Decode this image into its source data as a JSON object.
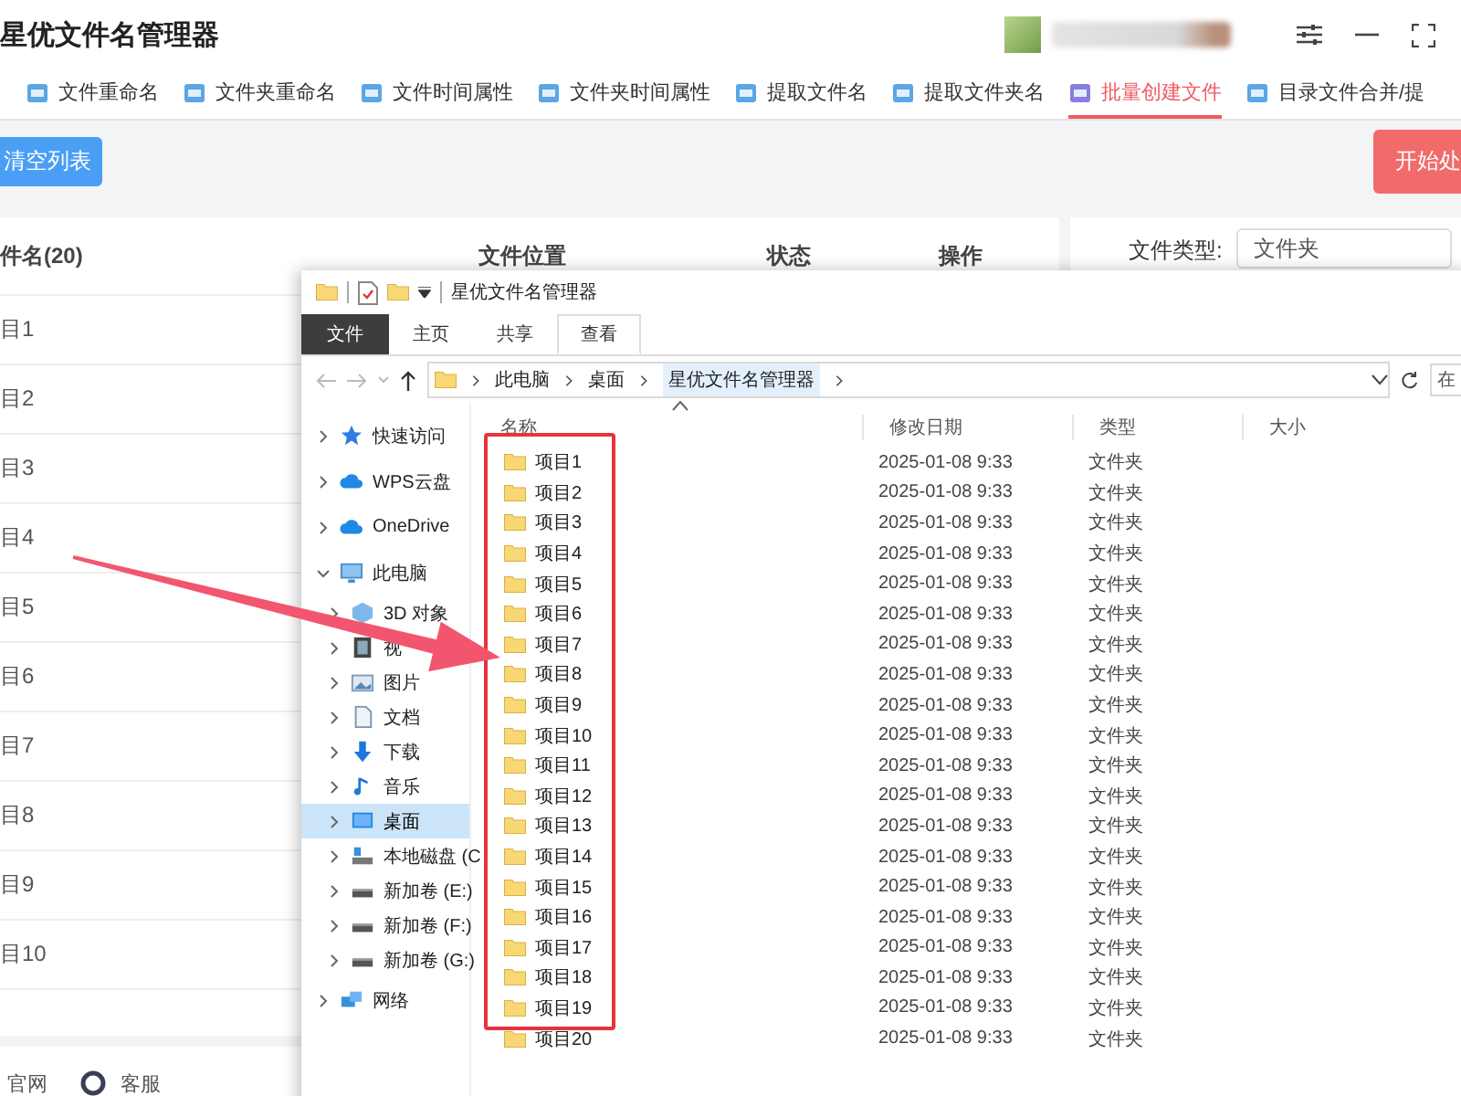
{
  "app": {
    "title": "星优文件名管理器",
    "tabs": [
      {
        "label": "文件重命名",
        "selected": false
      },
      {
        "label": "文件夹重命名",
        "selected": false
      },
      {
        "label": "文件时间属性",
        "selected": false
      },
      {
        "label": "文件夹时间属性",
        "selected": false
      },
      {
        "label": "提取文件名",
        "selected": false
      },
      {
        "label": "提取文件夹名",
        "selected": false
      },
      {
        "label": "批量创建文件",
        "selected": true
      },
      {
        "label": "目录文件合并/提",
        "selected": false
      }
    ],
    "clear_button": "清空列表",
    "start_button": "开始处",
    "table": {
      "columns": [
        "件名(20)",
        "文件位置",
        "状态",
        "操作"
      ],
      "rows": [
        "目1",
        "目2",
        "目3",
        "目4",
        "目5",
        "目6",
        "目7",
        "目8",
        "目9",
        "目10"
      ]
    },
    "file_type": {
      "label": "文件类型:",
      "value": "文件夹"
    },
    "footer": [
      "官网",
      "客服"
    ]
  },
  "explorer": {
    "title": "星优文件名管理器",
    "ribbon_tabs": [
      {
        "label": "文件",
        "kind": "menu",
        "selected": false
      },
      {
        "label": "主页",
        "kind": "tab",
        "selected": false
      },
      {
        "label": "共享",
        "kind": "tab",
        "selected": false
      },
      {
        "label": "查看",
        "kind": "tab",
        "selected": true
      }
    ],
    "breadcrumb": [
      "此电脑",
      "桌面",
      "星优文件名管理器"
    ],
    "search": {
      "placeholder": "在"
    },
    "columns": [
      "名称",
      "修改日期",
      "类型",
      "大小"
    ],
    "nav": [
      {
        "label": "快速访问",
        "kind": "star",
        "selected": false,
        "expanded": false
      },
      {
        "label": "WPS云盘",
        "kind": "cloud",
        "selected": false,
        "expanded": false
      },
      {
        "label": "OneDrive",
        "kind": "cloud",
        "selected": false,
        "expanded": false
      },
      {
        "label": "此电脑",
        "kind": "pc",
        "selected": false,
        "expanded": true,
        "children": [
          {
            "label": "3D 对象",
            "kind": "cube",
            "selected": false,
            "expanded": false
          },
          {
            "label": "视",
            "kind": "film",
            "selected": false,
            "expanded": false
          },
          {
            "label": "图片",
            "kind": "image",
            "selected": false,
            "expanded": false
          },
          {
            "label": "文档",
            "kind": "doc",
            "selected": false,
            "expanded": false
          },
          {
            "label": "下载",
            "kind": "download",
            "selected": false,
            "expanded": false
          },
          {
            "label": "音乐",
            "kind": "music",
            "selected": false,
            "expanded": false
          },
          {
            "label": "桌面",
            "kind": "desktop",
            "selected": true,
            "expanded": false
          },
          {
            "label": "本地磁盘 (C",
            "kind": "disk",
            "selected": false,
            "expanded": false
          },
          {
            "label": "新加卷 (E:)",
            "kind": "drive",
            "selected": false,
            "expanded": false
          },
          {
            "label": "新加卷 (F:)",
            "kind": "drive",
            "selected": false,
            "expanded": false
          },
          {
            "label": "新加卷 (G:)",
            "kind": "drive",
            "selected": false,
            "expanded": false
          }
        ]
      },
      {
        "label": "网络",
        "kind": "network",
        "selected": false,
        "expanded": false
      }
    ],
    "files": [
      {
        "name": "项目1",
        "date": "2025-01-08 9:33",
        "type": "文件夹"
      },
      {
        "name": "项目2",
        "date": "2025-01-08 9:33",
        "type": "文件夹"
      },
      {
        "name": "项目3",
        "date": "2025-01-08 9:33",
        "type": "文件夹"
      },
      {
        "name": "项目4",
        "date": "2025-01-08 9:33",
        "type": "文件夹"
      },
      {
        "name": "项目5",
        "date": "2025-01-08 9:33",
        "type": "文件夹"
      },
      {
        "name": "项目6",
        "date": "2025-01-08 9:33",
        "type": "文件夹"
      },
      {
        "name": "项目7",
        "date": "2025-01-08 9:33",
        "type": "文件夹"
      },
      {
        "name": "项目8",
        "date": "2025-01-08 9:33",
        "type": "文件夹"
      },
      {
        "name": "项目9",
        "date": "2025-01-08 9:33",
        "type": "文件夹"
      },
      {
        "name": "项目10",
        "date": "2025-01-08 9:33",
        "type": "文件夹"
      },
      {
        "name": "项目11",
        "date": "2025-01-08 9:33",
        "type": "文件夹"
      },
      {
        "name": "项目12",
        "date": "2025-01-08 9:33",
        "type": "文件夹"
      },
      {
        "name": "项目13",
        "date": "2025-01-08 9:33",
        "type": "文件夹"
      },
      {
        "name": "项目14",
        "date": "2025-01-08 9:33",
        "type": "文件夹"
      },
      {
        "name": "项目15",
        "date": "2025-01-08 9:33",
        "type": "文件夹"
      },
      {
        "name": "项目16",
        "date": "2025-01-08 9:33",
        "type": "文件夹"
      },
      {
        "name": "项目17",
        "date": "2025-01-08 9:33",
        "type": "文件夹"
      },
      {
        "name": "项目18",
        "date": "2025-01-08 9:33",
        "type": "文件夹"
      },
      {
        "name": "项目19",
        "date": "2025-01-08 9:33",
        "type": "文件夹"
      },
      {
        "name": "项目20",
        "date": "2025-01-08 9:33",
        "type": "文件夹"
      }
    ]
  }
}
